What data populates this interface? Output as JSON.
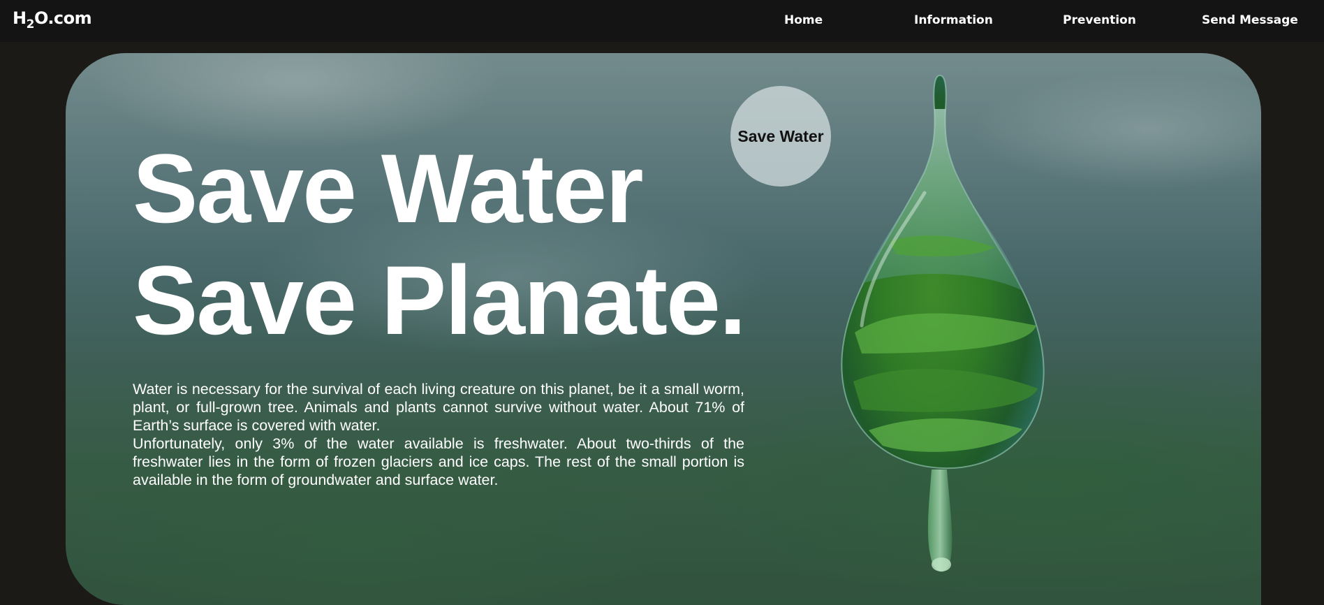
{
  "nav": {
    "logo": {
      "prefix": "H",
      "subscript": "2",
      "suffix": "O.com"
    },
    "items": [
      {
        "label": "Home"
      },
      {
        "label": "Information"
      },
      {
        "label": "Prevention"
      },
      {
        "label": "Send Message"
      }
    ]
  },
  "hero": {
    "headline_line1": "Save Water",
    "headline_line2": "Save Planate.",
    "badge_label": "Save Water",
    "paragraph1": "Water is necessary for the survival of each living creature on this planet, be it a small worm, plant, or full-grown tree. Animals and plants cannot survive without water. About 71% of Earth’s surface is covered with water.",
    "paragraph2": "Unfortunately, only 3% of the water available is freshwater. About two-thirds of the freshwater lies in the form of frozen glaciers and ice caps. The rest of the small portion is available in the form of groundwater and surface water."
  },
  "colors": {
    "nav_background": "#141414",
    "page_background": "#1b1a17",
    "text": "#ffffff",
    "badge_background": "#d7e1e2"
  }
}
